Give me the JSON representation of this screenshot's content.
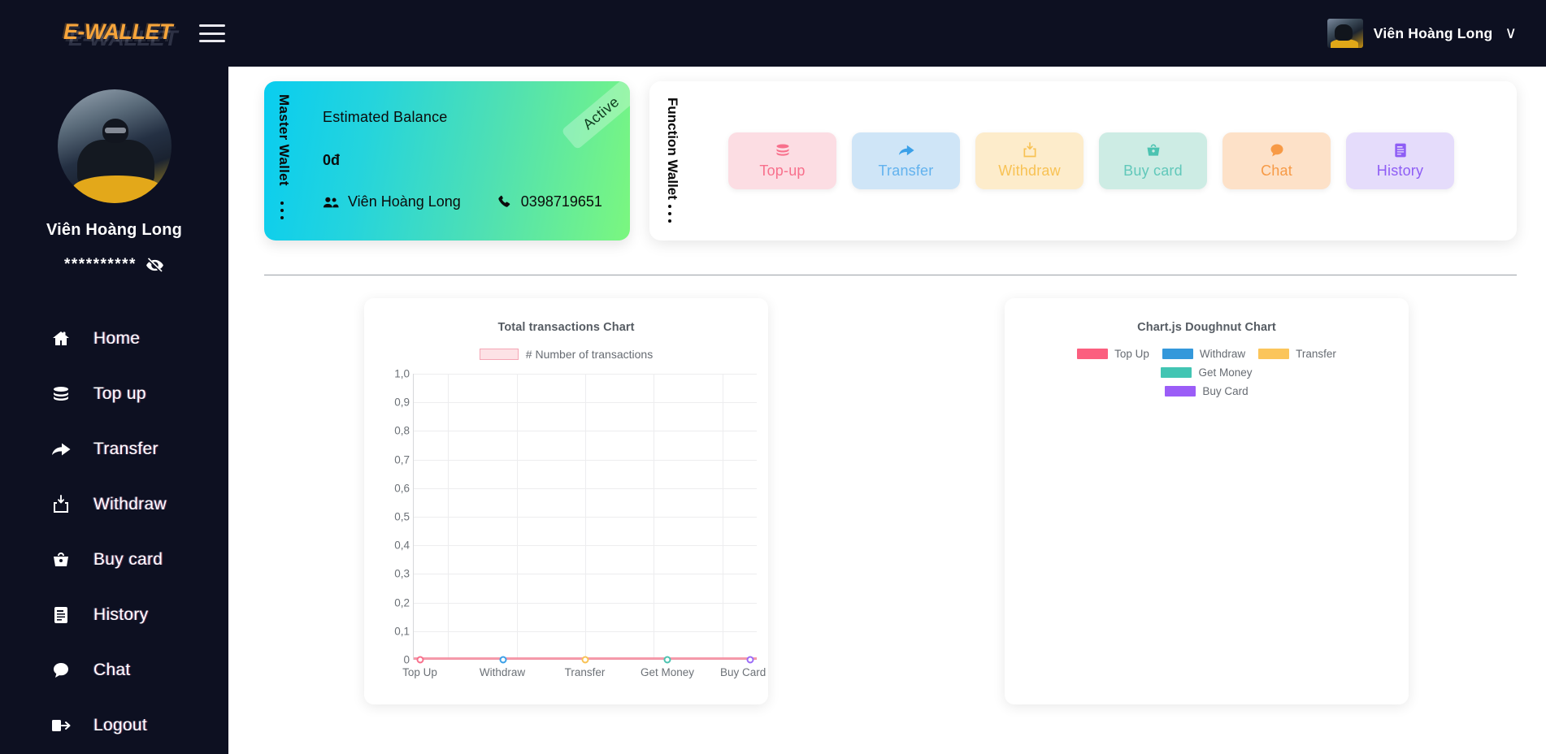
{
  "topbar": {
    "brand": "E-WALLET",
    "menu_icon": "hamburger-icon",
    "user_name": "Viên Hoàng Long",
    "chevron": "∨"
  },
  "sidebar": {
    "profile_name": "Viên Hoàng Long",
    "password_mask": "**********",
    "eye_icon": "eye-off-icon",
    "items": [
      {
        "label": "Home",
        "icon": "home-icon"
      },
      {
        "label": "Top up",
        "icon": "coins-icon"
      },
      {
        "label": "Transfer",
        "icon": "share-arrow-icon"
      },
      {
        "label": "Withdraw",
        "icon": "download-box-icon"
      },
      {
        "label": "Buy card",
        "icon": "basket-icon"
      },
      {
        "label": "History",
        "icon": "document-icon"
      },
      {
        "label": "Chat",
        "icon": "chat-bubble-icon"
      },
      {
        "label": "Logout",
        "icon": "logout-icon"
      }
    ]
  },
  "balance_card": {
    "vertical_label": "Master Wallet",
    "title": "Estimated Balance",
    "amount": "0đ",
    "owner": "Viên Hoàng Long",
    "phone": "0398719651",
    "status_badge": "Active",
    "gradient_from": "#09cdf0",
    "gradient_to": "#7bf77f"
  },
  "function_wallet": {
    "vertical_label": "Function Wallet",
    "buttons": [
      {
        "label": "Top-up",
        "icon": "coins-icon",
        "bg": "#fcdde3",
        "fg": "#f8708c"
      },
      {
        "label": "Transfer",
        "icon": "share-arrow-icon",
        "bg": "#cfe5f7",
        "fg": "#3ba0e8"
      },
      {
        "label": "Withdraw",
        "icon": "download-box-icon",
        "bg": "#fdeccb",
        "fg": "#f8c254"
      },
      {
        "label": "Buy card",
        "icon": "basket-icon",
        "bg": "#cdece4",
        "fg": "#4cc3b1"
      },
      {
        "label": "Chat",
        "icon": "chat-bubble-icon",
        "bg": "#fde1c8",
        "fg": "#f79a46"
      },
      {
        "label": "History",
        "icon": "document-icon",
        "bg": "#e5dcfb",
        "fg": "#8e5df5"
      }
    ]
  },
  "chart_data": [
    {
      "type": "line",
      "title": "Total transactions Chart",
      "legend": [
        {
          "label": "# Number of transactions",
          "fill": "#fde2e6",
          "border": "#f4a6b5"
        }
      ],
      "legend_position": "top",
      "categories": [
        "Top Up",
        "Withdraw",
        "Transfer",
        "Get Money",
        "Buy Card"
      ],
      "values": [
        0,
        0,
        0,
        0,
        0
      ],
      "point_colors": [
        "#f8708c",
        "#3ba0e8",
        "#f8c254",
        "#4cc3b1",
        "#9b6bf7"
      ],
      "line_color": "#f58a9c",
      "ylim": [
        0,
        1
      ],
      "yticks": [
        "0",
        "0,1",
        "0,2",
        "0,3",
        "0,4",
        "0,5",
        "0,6",
        "0,7",
        "0,8",
        "0,9",
        "1,0"
      ],
      "xlabel": "",
      "ylabel": "",
      "grid": true
    },
    {
      "type": "doughnut",
      "title": "Chart.js Doughnut Chart",
      "legend_position": "top",
      "labels": [
        "Top Up",
        "Withdraw",
        "Transfer",
        "Get Money",
        "Buy Card"
      ],
      "values": [
        0,
        0,
        0,
        0,
        0
      ],
      "colors": [
        "#fb5f7f",
        "#3498db",
        "#fbc55b",
        "#42c5b3",
        "#9b5df7"
      ]
    }
  ]
}
